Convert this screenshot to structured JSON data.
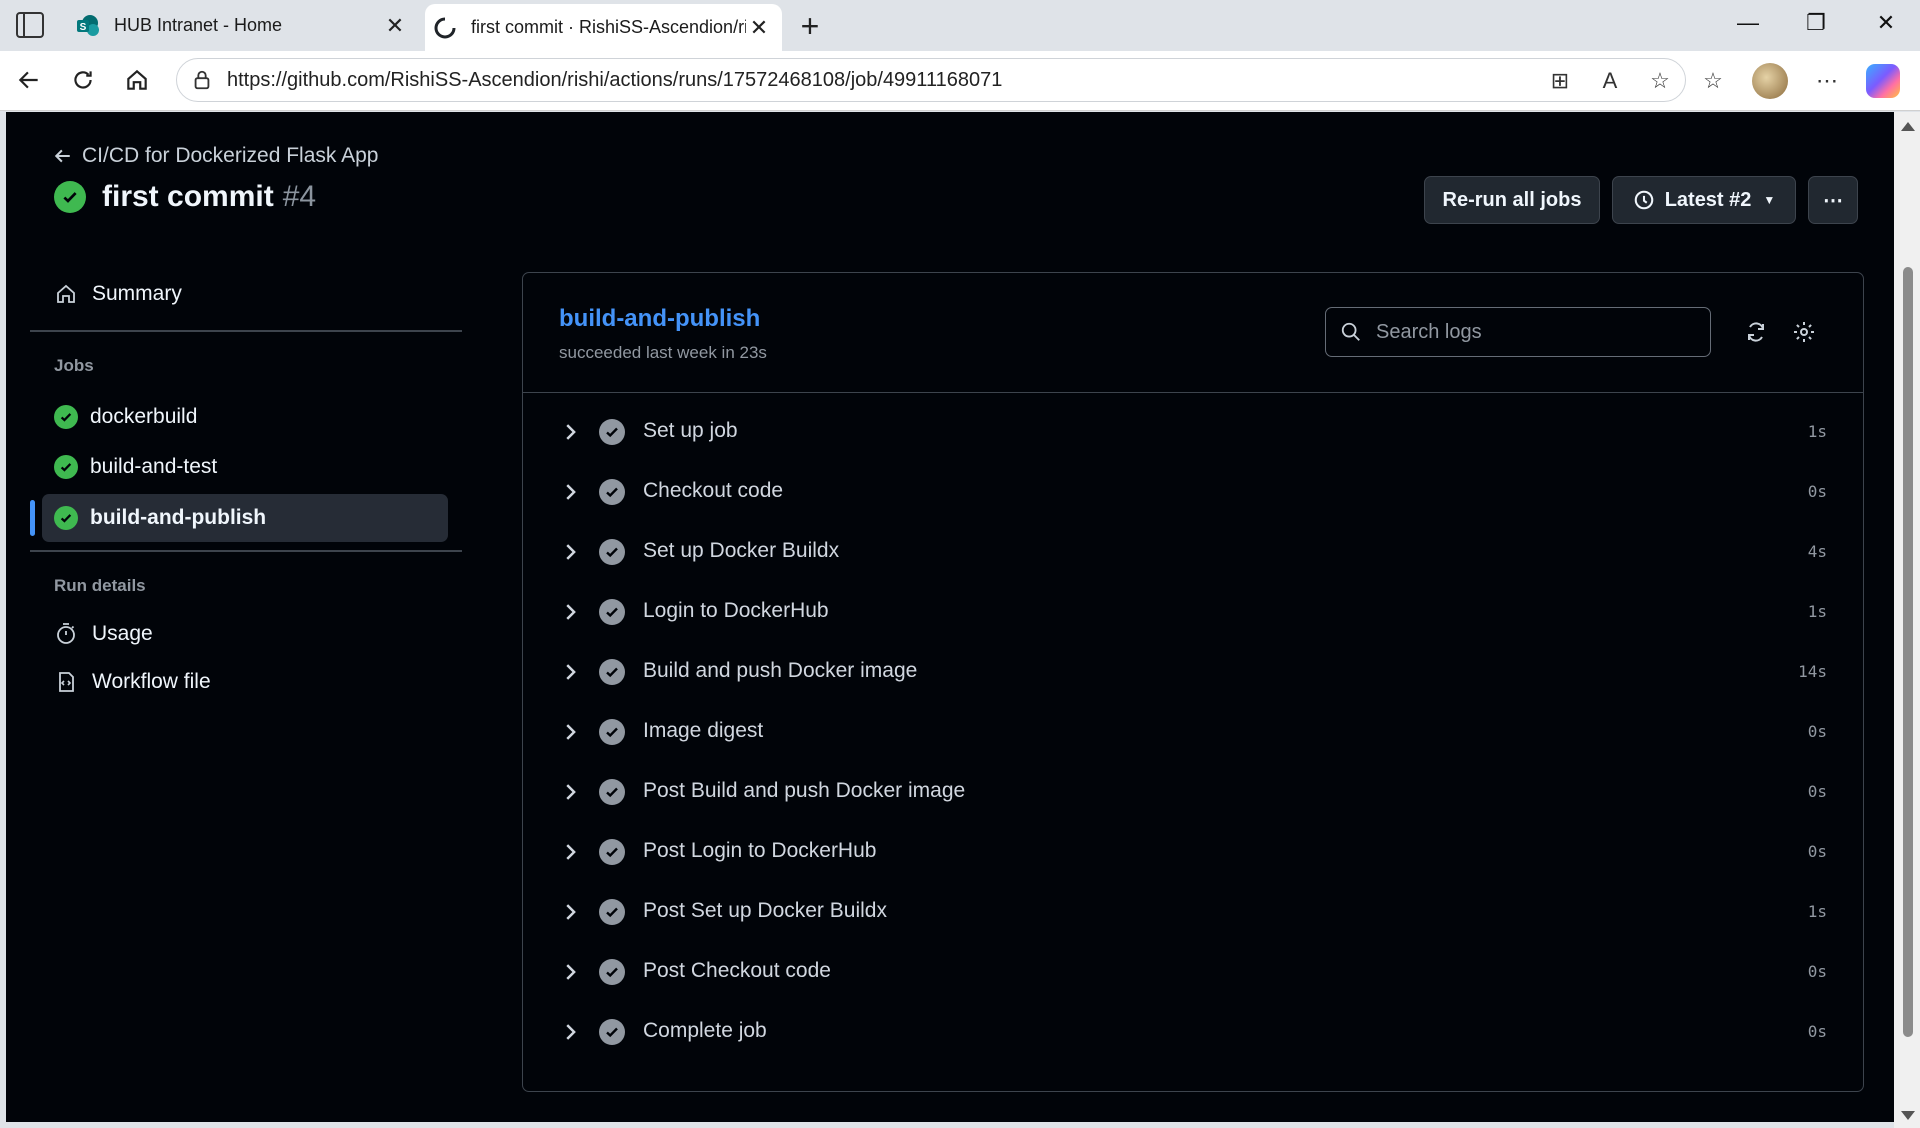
{
  "browser": {
    "tabs": [
      {
        "title": "HUB Intranet - Home"
      },
      {
        "title": "first commit · RishiSS-Ascendion/rishi"
      }
    ],
    "url": "https://github.com/RishiSS-Ascendion/rishi/actions/runs/17572468108/job/49911168071"
  },
  "header": {
    "back_label": "CI/CD for Dockerized Flask App",
    "title": "first commit",
    "run_number": "#4",
    "rerun_label": "Re-run all jobs",
    "attempt_label": "Latest #2"
  },
  "sidebar": {
    "summary_label": "Summary",
    "jobs_heading": "Jobs",
    "jobs": [
      {
        "label": "dockerbuild"
      },
      {
        "label": "build-and-test"
      },
      {
        "label": "build-and-publish"
      }
    ],
    "run_details_heading": "Run details",
    "usage_label": "Usage",
    "workflow_label": "Workflow file"
  },
  "job": {
    "name": "build-and-publish",
    "status": "succeeded last week in 23s",
    "search_placeholder": "Search logs",
    "steps": [
      {
        "name": "Set up job",
        "duration": "1s"
      },
      {
        "name": "Checkout code",
        "duration": "0s"
      },
      {
        "name": "Set up Docker Buildx",
        "duration": "4s"
      },
      {
        "name": "Login to DockerHub",
        "duration": "1s"
      },
      {
        "name": "Build and push Docker image",
        "duration": "14s"
      },
      {
        "name": "Image digest",
        "duration": "0s"
      },
      {
        "name": "Post Build and push Docker image",
        "duration": "0s"
      },
      {
        "name": "Post Login to DockerHub",
        "duration": "0s"
      },
      {
        "name": "Post Set up Docker Buildx",
        "duration": "1s"
      },
      {
        "name": "Post Checkout code",
        "duration": "0s"
      },
      {
        "name": "Complete job",
        "duration": "0s"
      }
    ]
  },
  "colors": {
    "success": "#3fb950",
    "link": "#4493f8",
    "background": "#010409"
  }
}
